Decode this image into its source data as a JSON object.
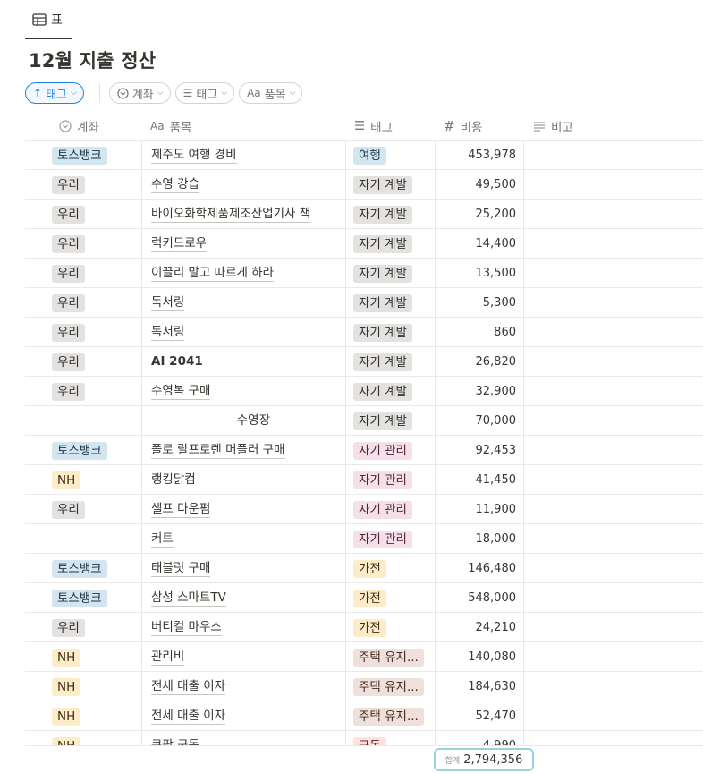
{
  "view": {
    "tab_label": "표"
  },
  "page_title": "12월 지출 정산",
  "filters": [
    {
      "label": "태그",
      "icon": "arrow-up-icon",
      "active": true
    },
    {
      "label": "계좌",
      "icon": "select-icon",
      "active": false
    },
    {
      "label": "태그",
      "icon": "list-icon",
      "active": false
    },
    {
      "label": "품목",
      "icon": "text-icon",
      "prefix": "Aa",
      "active": false
    }
  ],
  "columns": {
    "account": "계좌",
    "item": "품목",
    "item_prefix": "Aa",
    "tag": "태그",
    "cost": "비용",
    "cost_prefix": "#",
    "note": "비고"
  },
  "rows": [
    {
      "account": "토스뱅크",
      "item": "제주도 여행 경비",
      "tag": "여행",
      "cost": "453,978",
      "note": ""
    },
    {
      "account": "우리",
      "item": "수영 강습",
      "tag": "자기 계발",
      "cost": "49,500",
      "note": ""
    },
    {
      "account": "우리",
      "item": "바이오화학제품제조산업기사 책",
      "tag": "자기 계발",
      "cost": "25,200",
      "note": ""
    },
    {
      "account": "우리",
      "item": "럭키드로우",
      "tag": "자기 계발",
      "cost": "14,400",
      "note": ""
    },
    {
      "account": "우리",
      "item": "이끌리 말고 따르게 하라",
      "tag": "자기 계발",
      "cost": "13,500",
      "note": ""
    },
    {
      "account": "우리",
      "item": "독서링",
      "tag": "자기 계발",
      "cost": "5,300",
      "note": ""
    },
    {
      "account": "우리",
      "item": "독서링",
      "tag": "자기 계발",
      "cost": "860",
      "note": ""
    },
    {
      "account": "우리",
      "item": "AI 2041",
      "tag": "자기 계발",
      "cost": "26,820",
      "note": ""
    },
    {
      "account": "우리",
      "item": "수영복 구매",
      "tag": "자기 계발",
      "cost": "32,900",
      "note": ""
    },
    {
      "account": "",
      "item": "수영장",
      "tag": "자기 계발",
      "cost": "70,000",
      "note": ""
    },
    {
      "account": "토스뱅크",
      "item": "폴로 랄프로렌 머플러 구매",
      "tag": "자기 관리",
      "cost": "92,453",
      "note": ""
    },
    {
      "account": "NH",
      "item": "랭킹닭컴",
      "tag": "자기 관리",
      "cost": "41,450",
      "note": ""
    },
    {
      "account": "우리",
      "item": "셀프 다운펌",
      "tag": "자기 관리",
      "cost": "11,900",
      "note": ""
    },
    {
      "account": "",
      "item": "커트",
      "tag": "자기 관리",
      "cost": "18,000",
      "note": ""
    },
    {
      "account": "토스뱅크",
      "item": "태블릿 구매",
      "tag": "가전",
      "cost": "146,480",
      "note": ""
    },
    {
      "account": "토스뱅크",
      "item": "삼성 스마트TV",
      "tag": "가전",
      "cost": "548,000",
      "note": ""
    },
    {
      "account": "우리",
      "item": "버티컬 마우스",
      "tag": "가전",
      "cost": "24,210",
      "note": ""
    },
    {
      "account": "NH",
      "item": "관리비",
      "tag": "주택 유지...",
      "cost": "140,080",
      "note": ""
    },
    {
      "account": "NH",
      "item": "전세 대출 이자",
      "tag": "주택 유지...",
      "cost": "184,630",
      "note": ""
    },
    {
      "account": "NH",
      "item": "전세 대출 이자",
      "tag": "주택 유지...",
      "cost": "52,470",
      "note": ""
    },
    {
      "account": "NH",
      "item": "쿠팡 구독",
      "tag": "구독",
      "cost": "4,990",
      "note": ""
    }
  ],
  "summary": {
    "label": "합계",
    "value": "2,794,356"
  },
  "colors": {
    "accent": "#2383e2",
    "summary_border": "#9ad3de",
    "account_toss": "#d3e5ef",
    "account_woori": "#e3e2e0",
    "account_nh": "#fdecc8",
    "tag_travel": "#d3e5ef",
    "tag_self_dev": "#e3e2e0",
    "tag_self_care": "#f5e0e9",
    "tag_appliance": "#fdecc8",
    "tag_housing": "#eee0da",
    "tag_subscription": "#ffe2dd"
  }
}
